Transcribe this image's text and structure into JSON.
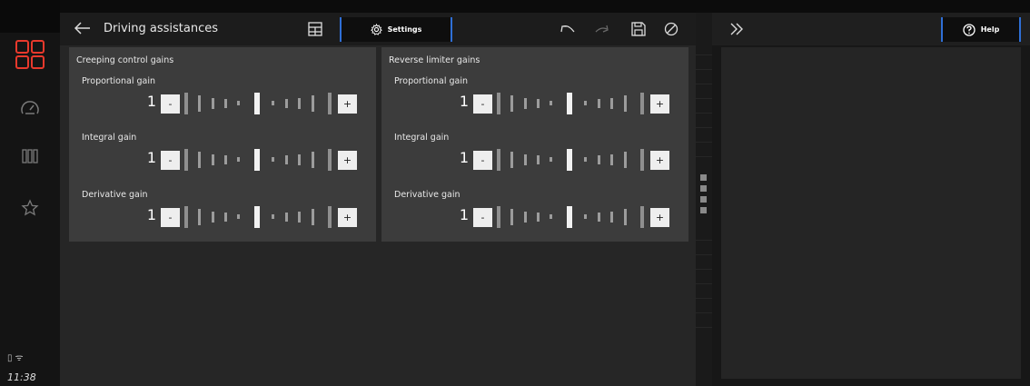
{
  "status": {
    "clock": "11:38"
  },
  "rail": {
    "items": [
      {
        "icon": "apps-grid-icon",
        "active": true
      },
      {
        "icon": "speedometer-icon",
        "active": false
      },
      {
        "icon": "columns-icon",
        "active": false
      },
      {
        "icon": "star-icon",
        "active": false
      }
    ]
  },
  "header": {
    "title": "Driving assistances",
    "settings_tab_label": "Settings"
  },
  "help": {
    "label": "Help"
  },
  "cards": [
    {
      "title": "Creeping control gains",
      "gains": [
        {
          "label": "Proportional gain",
          "value": "1",
          "minus": "-",
          "plus": "+"
        },
        {
          "label": "Integral gain",
          "value": "1",
          "minus": "-",
          "plus": "+"
        },
        {
          "label": "Derivative gain",
          "value": "1",
          "minus": "-",
          "plus": "+"
        }
      ]
    },
    {
      "title": "Reverse limiter gains",
      "gains": [
        {
          "label": "Proportional gain",
          "value": "1",
          "minus": "-",
          "plus": "+"
        },
        {
          "label": "Integral gain",
          "value": "1",
          "minus": "-",
          "plus": "+"
        },
        {
          "label": "Derivative gain",
          "value": "1",
          "minus": "-",
          "plus": "+"
        }
      ]
    }
  ],
  "colors": {
    "accent_red": "#e8392c",
    "accent_blue": "#2f6fd6"
  }
}
